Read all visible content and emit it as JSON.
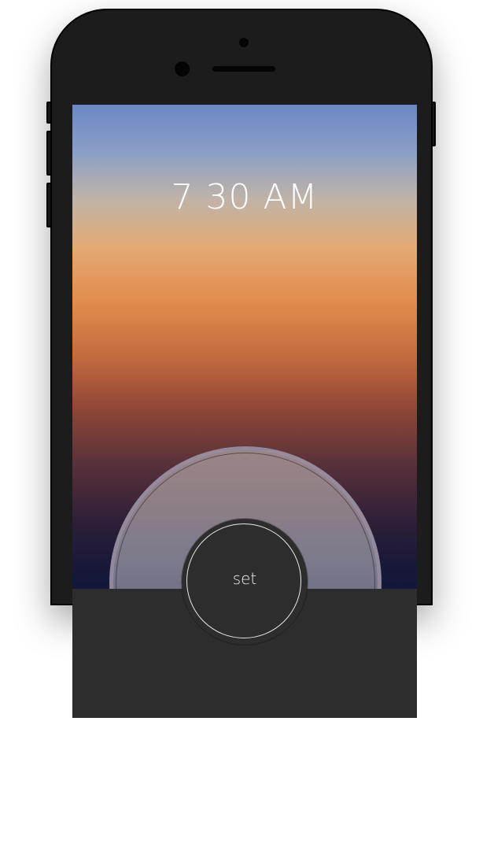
{
  "alarm": {
    "time_display": "7 30 AM",
    "set_label": "set"
  },
  "colors": {
    "sky_top": "#6c87c6",
    "sky_orange": "#e28c4e",
    "sky_bottom": "#11163a",
    "panel": "#2d2d2d",
    "device_body": "#1c1c1c"
  }
}
